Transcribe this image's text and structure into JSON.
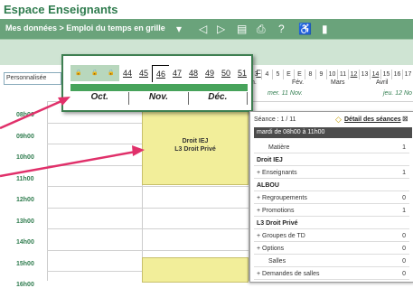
{
  "title": "Espace Enseignants",
  "toolbar": {
    "breadcrumb": "Mes données > Emploi du temps en grille"
  },
  "select": {
    "value": "Personnalisée"
  },
  "week_strip": [
    "3",
    "4",
    "5",
    "E",
    "E",
    "8",
    "9",
    "10",
    "11",
    "12",
    "13",
    "14",
    "15",
    "16",
    "17"
  ],
  "week_underlined": [
    "12",
    "14"
  ],
  "months_right": [
    "n.",
    "Fév.",
    "Mars",
    "Avril"
  ],
  "day_headers": [
    "mer. 11 Nov.",
    "jeu. 12 No"
  ],
  "hours": [
    "08h00",
    "09h00",
    "10h00",
    "11h00",
    "12h00",
    "13h00",
    "14h00",
    "15h00",
    "16h00"
  ],
  "zoom": {
    "weeks": [
      "",
      "",
      "",
      "44",
      "45",
      "46",
      "47",
      "48",
      "49",
      "50",
      "51",
      "F"
    ],
    "months": [
      "Oct.",
      "Nov.",
      "Déc."
    ]
  },
  "course": {
    "line1": "Droit IEJ",
    "line2": "L3 Droit Privé"
  },
  "panel": {
    "seance": "Séance : 1 / 11",
    "link": "Détail des séances",
    "date": "mardi de 08h00 à 11h00",
    "rows": [
      {
        "label": "Matière",
        "value": "1",
        "bold": false,
        "plus": false
      },
      {
        "label": "Droit IEJ",
        "value": "",
        "bold": true,
        "plus": false
      },
      {
        "label": "Enseignants",
        "value": "1",
        "bold": false,
        "plus": true
      },
      {
        "label": "ALBOU",
        "value": "",
        "bold": true,
        "plus": false
      },
      {
        "label": "Regroupements",
        "value": "0",
        "bold": false,
        "plus": true
      },
      {
        "label": "Promotions",
        "value": "1",
        "bold": false,
        "plus": true
      },
      {
        "label": "L3 Droit Privé",
        "value": "",
        "bold": true,
        "plus": false
      },
      {
        "label": "Groupes de TD",
        "value": "0",
        "bold": false,
        "plus": true
      },
      {
        "label": "Options",
        "value": "0",
        "bold": false,
        "plus": true
      },
      {
        "label": "Salles",
        "value": "0",
        "bold": false,
        "plus": false
      },
      {
        "label": "Demandes de salles",
        "value": "0",
        "bold": false,
        "plus": true
      }
    ]
  },
  "colors": {
    "brand_green": "#2f7c4e",
    "toolbar": "#6aa37b",
    "course": "#f2ee9a",
    "arrow": "#e0306a"
  }
}
